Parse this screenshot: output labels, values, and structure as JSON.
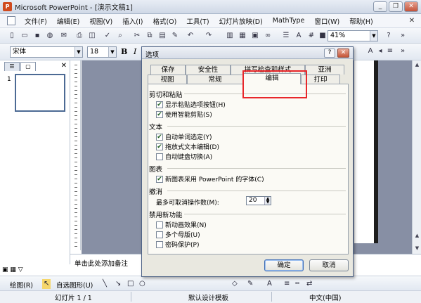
{
  "window": {
    "title": "Microsoft PowerPoint - [演示文稿1]",
    "app_icon": "P"
  },
  "menu": {
    "items": [
      "文件(F)",
      "编辑(E)",
      "视图(V)",
      "插入(I)",
      "格式(O)",
      "工具(T)",
      "幻灯片放映(D)",
      "MathType",
      "窗口(W)",
      "帮助(H)"
    ]
  },
  "toolbar": {
    "zoom": "41%",
    "font_name": "宋体",
    "font_size": "18",
    "bold_label": "B",
    "italic_label": "I"
  },
  "notes_placeholder": "单击此处添加备注",
  "left_pane": {
    "slide_number": "1"
  },
  "draw_toolbar": {
    "draw_label": "绘图(R)",
    "autoshape_label": "自选图形(U)"
  },
  "status": {
    "slide_info": "幻灯片 1 / 1",
    "design": "默认设计模板",
    "language": "中文(中国)"
  },
  "dialog": {
    "title": "选项",
    "tabs_back": [
      "保存",
      "安全性",
      "拼写检查和样式",
      "亚洲"
    ],
    "tabs_front": [
      "视图",
      "常规",
      "编辑",
      "打印"
    ],
    "active_tab": "编辑",
    "groups": {
      "cut_paste": "剪切和粘贴",
      "text": "文本",
      "chart": "图表",
      "undo": "撤消",
      "disable_new": "禁用新功能"
    },
    "options": {
      "show_paste_buttons": "显示粘贴选项按钮(H)",
      "smart_cut_paste": "使用智能剪贴(S)",
      "auto_select_word": "自动单词选定(Y)",
      "drag_drop_text": "拖放式文本编辑(D)",
      "auto_keyboard": "自动键盘切换(A)",
      "new_chart_font": "新图表采用 PowerPoint 的字体(C)",
      "undo_levels_label": "最多可取消操作数(M):",
      "undo_levels_value": "20",
      "new_animation": "新动画效果(N)",
      "multiple_masters": "多个母版(U)",
      "password_protect": "密码保护(P)"
    },
    "ok_label": "确定",
    "cancel_label": "取消"
  }
}
